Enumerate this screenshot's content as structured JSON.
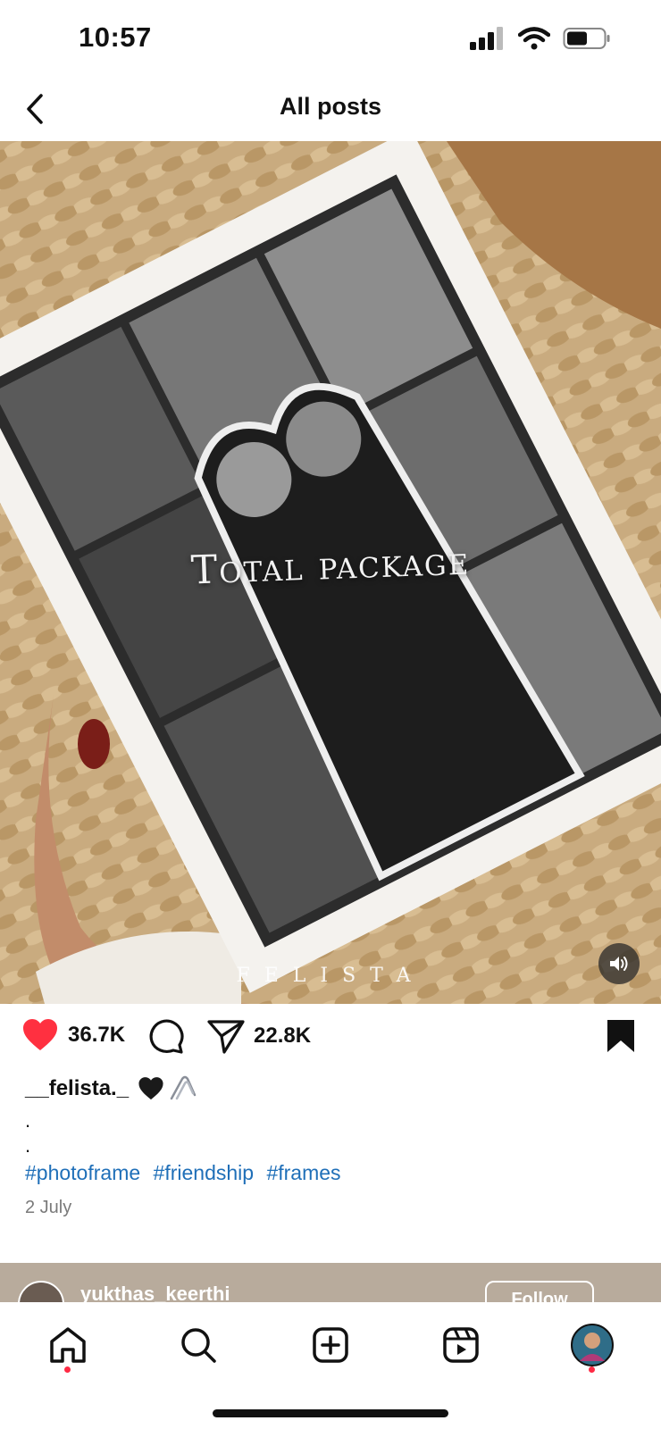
{
  "status": {
    "time": "10:57"
  },
  "nav": {
    "title": "All posts"
  },
  "media": {
    "overlay_text": "Total package",
    "watermark": "FELISTA"
  },
  "actions": {
    "likes": "36.7K",
    "shares": "22.8K",
    "colors": {
      "like": "#ff3040",
      "hashtag": "#1f6fb8"
    }
  },
  "caption": {
    "username": "__felista._",
    "dots": [
      ".",
      "."
    ],
    "hashtags": [
      "#photoframe",
      "#friendship",
      "#frames"
    ],
    "date": "2 July"
  },
  "next_post": {
    "username": "yukthas_keerthi",
    "follow_label": "Follow"
  },
  "tab_bar": {
    "items": [
      "home-icon",
      "search-icon",
      "create-icon",
      "reels-icon",
      "profile-avatar"
    ]
  }
}
